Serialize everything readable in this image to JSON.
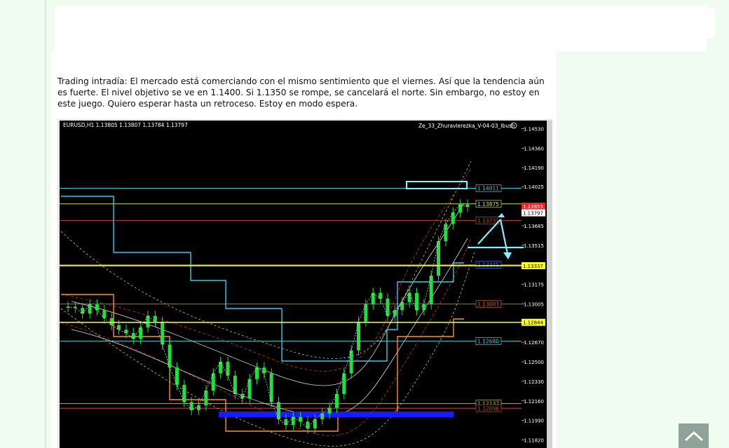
{
  "article": {
    "paragraph": "Trading intradía: El mercado está comerciando con el mismo sentimiento que el viernes. Así que la tendencia aún es fuerte. El nivel objetivo se ve en 1.1400. Si 1.1350 se rompe, se cancelará el norte. Sin embargo, no estoy en este juego. Quiero esperar hasta un retroceso. Estoy en modo espera."
  },
  "scroll_top_icon": "chevron-up-icon",
  "chart_data": {
    "type": "line",
    "symbol_header": "EURUSD,H1  1.13805 1.13807 1.13784 1.13797",
    "indicator_label": "Ze_33_Zhuravlerezka_V-04-03_Ibush",
    "ylim": [
      1.1175,
      1.146
    ],
    "y_ticks": [
      "1.14530",
      "1.14360",
      "1.14190",
      "1.14025",
      "1.13855",
      "1.13685",
      "1.13515",
      "1.13345",
      "1.13175",
      "1.13005",
      "1.12840",
      "1.12670",
      "1.12500",
      "1.12330",
      "1.12160",
      "1.11990",
      "1.11820"
    ],
    "levels": [
      {
        "label": "1.14011",
        "value": 1.14011,
        "color": "#3cc8d8"
      },
      {
        "label": "1.13875",
        "value": 1.13875,
        "color": "#d8d848"
      },
      {
        "label": "1.13731",
        "value": 1.13731,
        "color": "#c84030"
      },
      {
        "label": "1.13345",
        "value": 1.13345,
        "color": "#3070ff"
      },
      {
        "label": "1.13003",
        "value": 1.13003,
        "color": "#c86428"
      },
      {
        "label": "1.12680",
        "value": 1.1268,
        "color": "#3cc8d8"
      },
      {
        "label": "1.12137",
        "value": 1.12137,
        "color": "#b8b848"
      },
      {
        "label": "1.12096",
        "value": 1.12096,
        "color": "#c84030"
      }
    ],
    "price_tags": [
      {
        "label": "1.13855",
        "value": 1.13855,
        "bg": "#ff2020",
        "fg": "#ffffff"
      },
      {
        "label": "1.13797",
        "value": 1.13797,
        "bg": "#ffffff",
        "fg": "#000000"
      },
      {
        "label": "1.13337",
        "value": 1.13337,
        "bg": "#ffff20",
        "fg": "#000000"
      },
      {
        "label": "1.12844",
        "value": 1.12844,
        "bg": "#ffff20",
        "fg": "#000000"
      }
    ],
    "price_series": [
      1.1298,
      1.1297,
      1.1292,
      1.13,
      1.1295,
      1.1288,
      1.1282,
      1.1278,
      1.1275,
      1.127,
      1.128,
      1.129,
      1.1285,
      1.1265,
      1.1245,
      1.123,
      1.1215,
      1.1208,
      1.1212,
      1.1225,
      1.124,
      1.125,
      1.1238,
      1.1222,
      1.1218,
      1.1235,
      1.1245,
      1.124,
      1.1215,
      1.12,
      1.1195,
      1.1202,
      1.1198,
      1.1192,
      1.12,
      1.1205,
      1.121,
      1.1222,
      1.124,
      1.126,
      1.1285,
      1.13,
      1.131,
      1.1305,
      1.129,
      1.1295,
      1.1302,
      1.131,
      1.1295,
      1.13,
      1.1325,
      1.1355,
      1.137,
      1.138,
      1.1387,
      1.1385
    ]
  }
}
